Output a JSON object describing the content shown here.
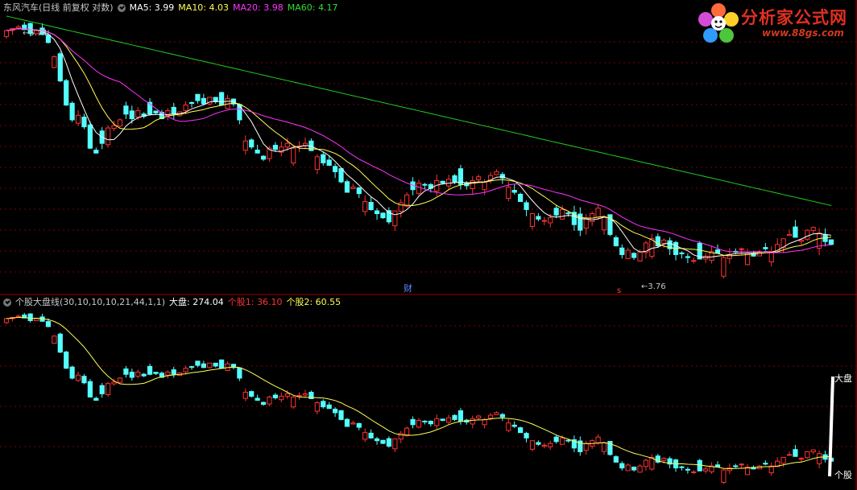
{
  "top_panel": {
    "stock_title": "东风汽车(日线 前复权 对数)",
    "ma5": "MA5: 3.99",
    "ma10": "MA10: 4.03",
    "ma20": "MA20: 3.98",
    "ma60": "MA60: 4.17",
    "high_annotation": "5.74",
    "low_annotation": "3.76",
    "marker_cai": "财",
    "marker_s": "s"
  },
  "bottom_panel": {
    "indicator_title": "个股大盘线(30,10,10,10,21,44,1,1)",
    "dapan": "大盘: 274.04",
    "gegu1": "个股1: 36.10",
    "gegu2": "个股2: 60.55",
    "label_dapan": "大盘",
    "label_gegu": "个股"
  },
  "logo": {
    "title": "分析家公式网",
    "url": "www.88gs.com"
  },
  "colors": {
    "up": "#ff3232",
    "down": "#54ffff",
    "ma5": "#ffffff",
    "ma10": "#ffff55",
    "ma20": "#ff33ff",
    "ma60": "#22cc22",
    "grid": "#7a0000",
    "divider": "#a00000"
  },
  "chart_data": [
    {
      "type": "candlestick",
      "title": "东风汽车(日线 前复权 对数)",
      "y_scale": "log",
      "ylim": [
        3.64,
        5.85
      ],
      "series": [
        {
          "name": "MA5",
          "last": 3.99
        },
        {
          "name": "MA10",
          "last": 4.03
        },
        {
          "name": "MA20",
          "last": 3.98
        },
        {
          "name": "MA60",
          "last": 4.17
        }
      ],
      "annotations": [
        {
          "text": "5.74",
          "type": "high"
        },
        {
          "text": "3.76",
          "type": "low"
        }
      ],
      "closes": [
        5.7,
        5.72,
        5.74,
        5.71,
        5.67,
        5.7,
        5.66,
        5.58,
        5.44,
        5.21,
        4.99,
        4.86,
        4.9,
        4.8,
        4.62,
        4.58,
        4.66,
        4.79,
        4.81,
        4.86,
        4.91,
        4.87,
        4.94,
        4.89,
        4.91,
        4.92,
        4.87,
        4.94,
        4.91,
        4.93,
        4.99,
        5.01,
        5.03,
        5.0,
        5.06,
        5.02,
        4.99,
        5.05,
        5.0,
        4.86,
        4.68,
        4.63,
        4.58,
        4.53,
        4.62,
        4.61,
        4.63,
        4.66,
        4.62,
        4.64,
        4.66,
        4.6,
        4.55,
        4.5,
        4.48,
        4.43,
        4.35,
        4.27,
        4.31,
        4.26,
        4.2,
        4.14,
        4.11,
        4.08,
        4.05,
        4.13,
        4.19,
        4.25,
        4.29,
        4.34,
        4.33,
        4.3,
        4.36,
        4.34,
        4.37,
        4.35,
        4.33,
        4.32,
        4.36,
        4.39,
        4.35,
        4.4,
        4.43,
        4.38,
        4.31,
        4.27,
        4.2,
        4.14,
        4.11,
        4.07,
        4.06,
        4.08,
        4.1,
        4.14,
        4.11,
        4.03,
        3.99,
        4.08,
        4.11,
        4.15,
        4.09,
        3.96,
        3.88,
        3.82,
        3.85,
        3.8,
        3.84,
        3.9,
        3.93,
        3.88,
        3.92,
        3.86,
        3.82,
        3.83,
        3.8,
        3.78,
        3.79,
        3.81,
        3.84,
        3.83,
        3.8,
        3.82,
        3.84,
        3.86,
        3.83,
        3.81,
        3.84,
        3.86,
        3.84,
        3.89,
        3.93,
        3.96,
        3.94,
        3.92,
        3.99,
        4.01,
        3.97,
        3.91,
        3.89
      ]
    },
    {
      "type": "candlestick",
      "title": "个股大盘线(30,10,10,10,21,44,1,1)",
      "series": [
        {
          "name": "大盘",
          "last": 274.04
        },
        {
          "name": "个股1",
          "last": 36.1
        },
        {
          "name": "个股2",
          "last": 60.55
        }
      ]
    }
  ]
}
